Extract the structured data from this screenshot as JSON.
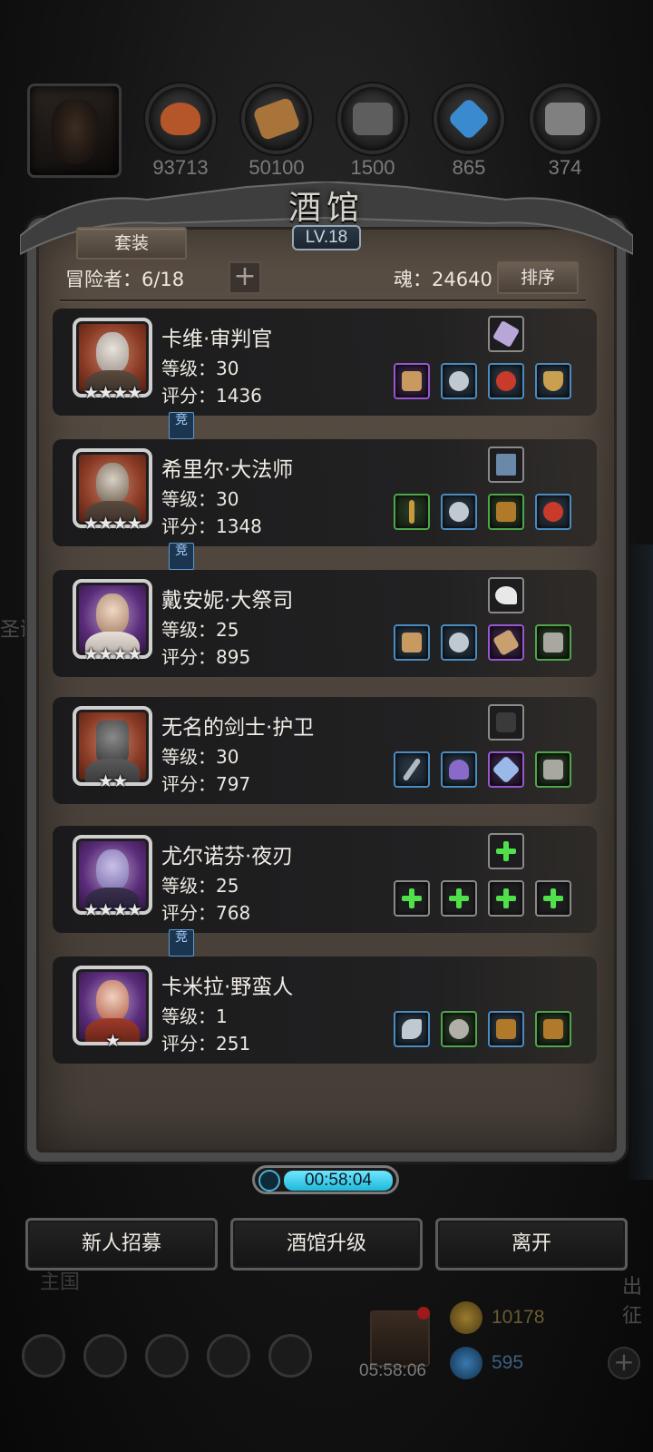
{
  "resources": [
    {
      "value": "93713",
      "icon": "meat-icon",
      "color": "#b5562a"
    },
    {
      "value": "50100",
      "icon": "wood-icon",
      "color": "#a9743a"
    },
    {
      "value": "1500",
      "icon": "stone-icon",
      "color": "#6a6a6a"
    },
    {
      "value": "865",
      "icon": "crystal-icon",
      "color": "#3a8ad0"
    },
    {
      "value": "374",
      "icon": "iron-icon",
      "color": "#808080"
    }
  ],
  "tavern": {
    "title": "酒馆",
    "level": "LV.18",
    "suit_button": "套装",
    "adventurers": "冒险者：6/18",
    "add_slot": "+",
    "soul": "魂：24640",
    "sort_button": "排序"
  },
  "heroes": [
    {
      "name": "卡维·审判官",
      "level": "等级：30",
      "score": "评分：1436",
      "stars": "★★★★",
      "frame": "red"
    },
    {
      "name": "希里尔·大法师",
      "level": "等级：30",
      "score": "评分：1348",
      "stars": "★★★★",
      "frame": "red"
    },
    {
      "name": "戴安妮·大祭司",
      "level": "等级：25",
      "score": "评分：895",
      "stars": "★★★★",
      "frame": "purple"
    },
    {
      "name": "无名的剑士·护卫",
      "level": "等级：30",
      "score": "评分：797",
      "stars": "★★",
      "frame": "red"
    },
    {
      "name": "尤尔诺芬·夜刃",
      "level": "等级：25",
      "score": "评分：768",
      "stars": "★★★★",
      "frame": "purple"
    },
    {
      "name": "卡米拉·野蛮人",
      "level": "等级：1",
      "score": "评分：251",
      "stars": "★",
      "frame": "purple"
    }
  ],
  "arena_tag": "竞",
  "timer": "00:58:04",
  "buttons": {
    "recruit": "新人招募",
    "upgrade": "酒馆升级",
    "leave": "离开"
  },
  "background": {
    "gift_timer": "05:58:06",
    "gold": "10178",
    "gems": "595",
    "left_text": "圣诞",
    "right_text": "出征",
    "bottom_left_text": "主国"
  }
}
